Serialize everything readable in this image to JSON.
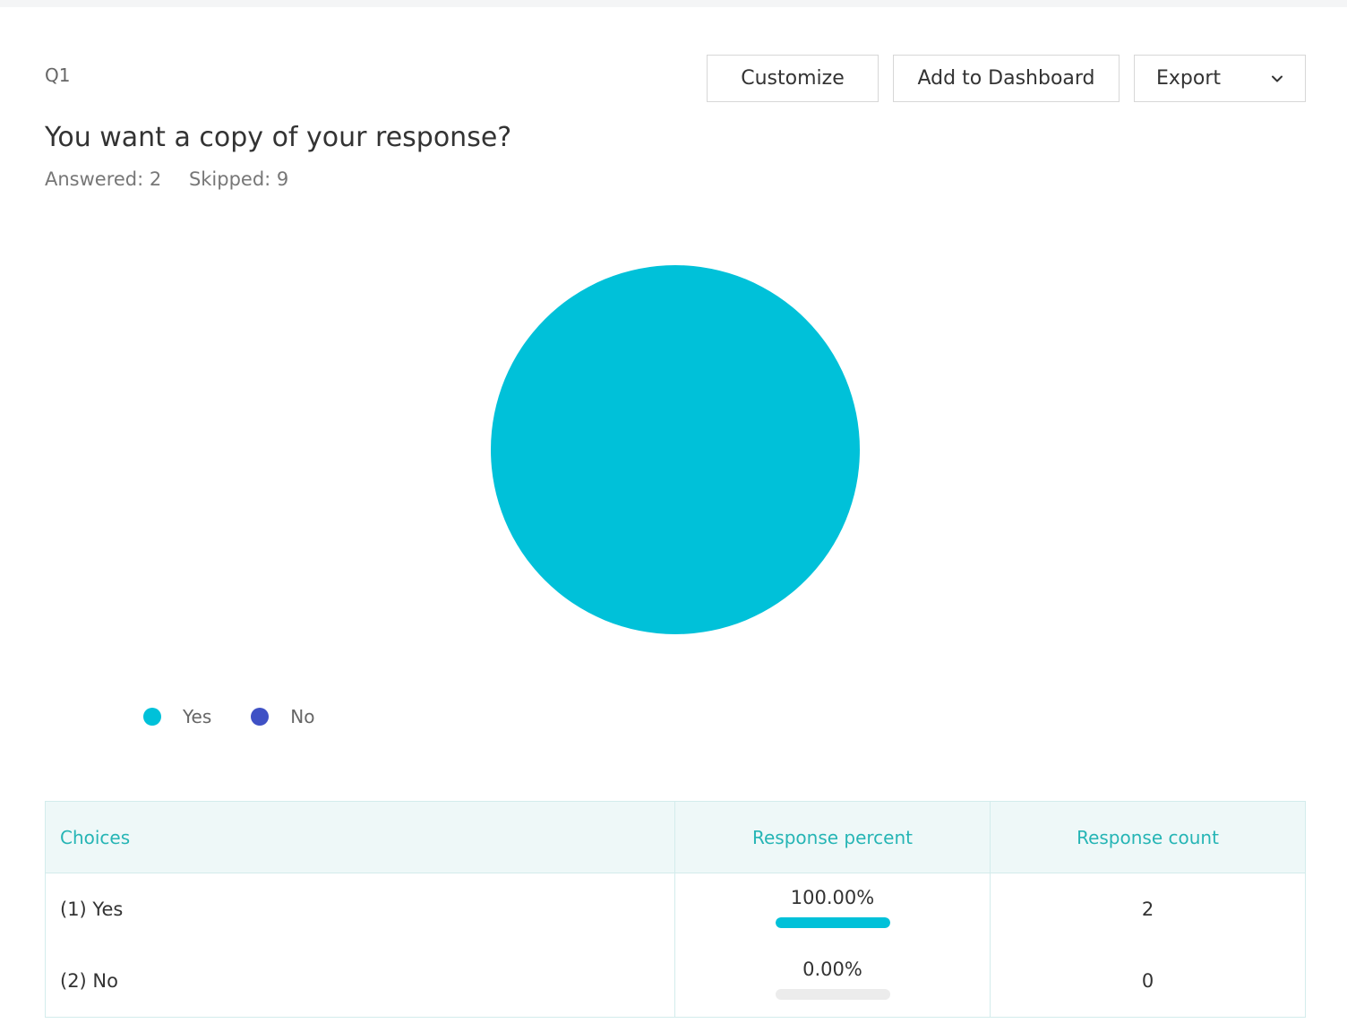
{
  "question": {
    "number": "Q1",
    "title": "You want a copy of your response?",
    "answered": "Answered: 2",
    "skipped": "Skipped: 9"
  },
  "toolbar": {
    "customize_label": "Customize",
    "dashboard_label": "Add to Dashboard",
    "export_label": "Export"
  },
  "colors": {
    "yes": "#00c1d9",
    "no": "#3f51c5",
    "header_text": "#26b5b5"
  },
  "chart_data": {
    "type": "pie",
    "categories": [
      "Yes",
      "No"
    ],
    "values": [
      2,
      0
    ],
    "colors": [
      "#00c1d9",
      "#3f51c5"
    ],
    "legend_position": "bottom-left"
  },
  "legend": [
    {
      "label": "Yes",
      "color": "#00c1d9"
    },
    {
      "label": "No",
      "color": "#3f51c5"
    }
  ],
  "table": {
    "headers": {
      "choices": "Choices",
      "percent": "Response percent",
      "count": "Response count"
    },
    "rows": [
      {
        "choice": "(1) Yes",
        "percent": "100.00%",
        "fraction": 1.0,
        "count": "2",
        "color": "#00c1d9"
      },
      {
        "choice": "(2) No",
        "percent": "0.00%",
        "fraction": 0.0,
        "count": "0",
        "color": "#3f51c5"
      }
    ]
  }
}
